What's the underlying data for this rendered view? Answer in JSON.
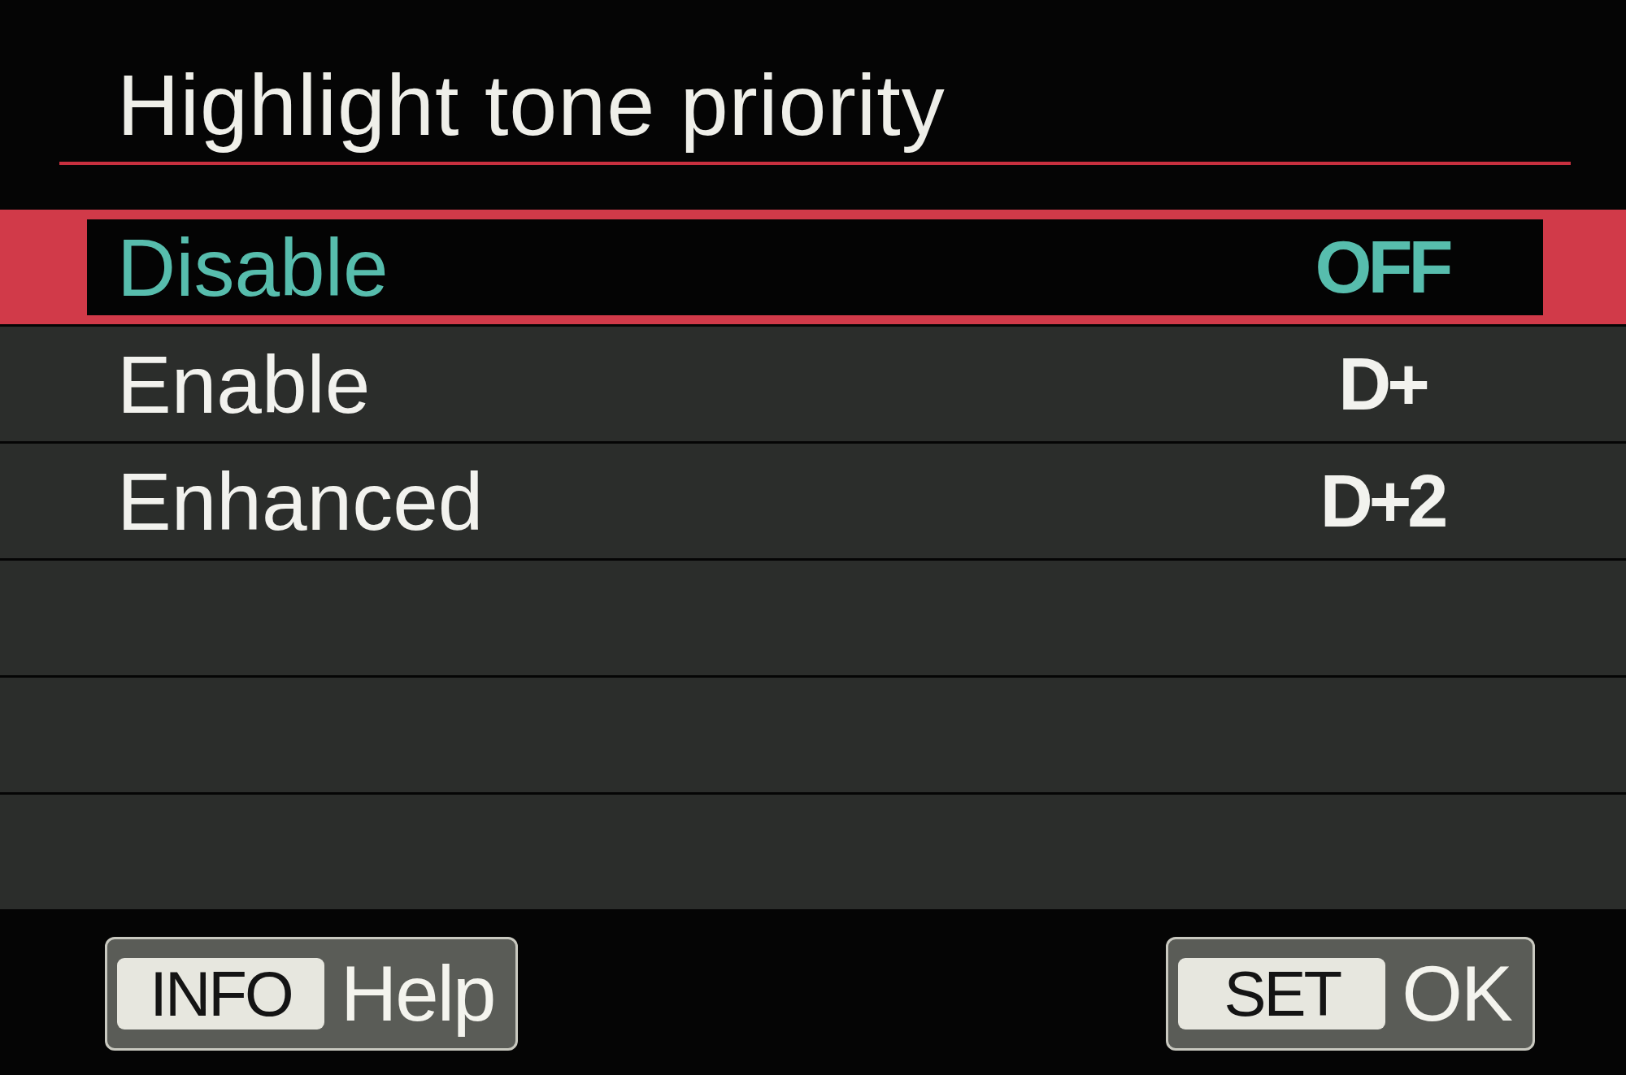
{
  "title": "Highlight tone priority",
  "options": [
    {
      "label": "Disable",
      "value": "OFF",
      "selected": true
    },
    {
      "label": "Enable",
      "value": "D+",
      "selected": false
    },
    {
      "label": "Enhanced",
      "value": "D+2",
      "selected": false
    }
  ],
  "footer_buttons": [
    {
      "key": "INFO",
      "label": "Help"
    },
    {
      "key": "SET",
      "label": "OK"
    }
  ]
}
